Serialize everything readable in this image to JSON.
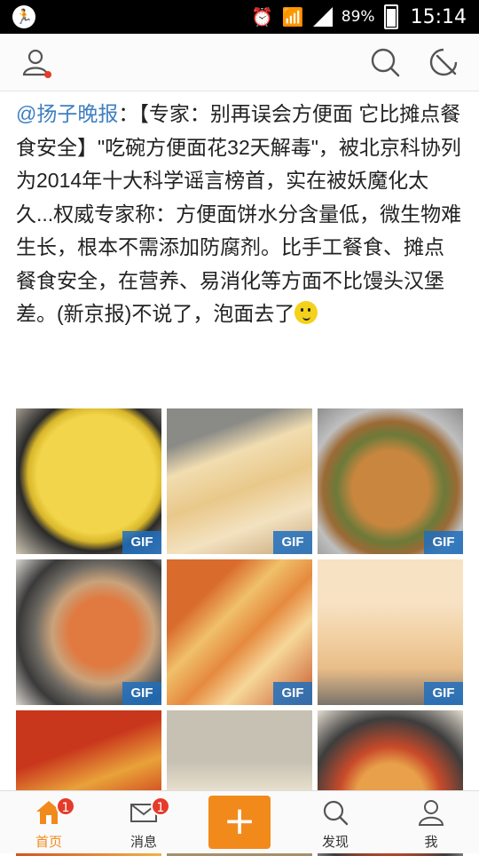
{
  "status_bar": {
    "battery": "89%",
    "time": "15:14"
  },
  "post": {
    "mention": "@扬子晚报",
    "text": "：【专家：别再误会方便面 它比摊点餐食安全】\"吃碗方便面花32天解毒\"，被北京科协列为2014年十大科学谣言榜首，实在被妖魔化太久...权威专家称：方便面饼水分含量低，微生物难生长，根本不需添加防腐剂。比手工餐食、摊点餐食安全，在营养、易消化等方面不比馒头汉堡差。(新京报)不说了，泡面去了",
    "images": [
      {
        "label": "GIF"
      },
      {
        "label": "GIF"
      },
      {
        "label": "GIF"
      },
      {
        "label": "GIF"
      },
      {
        "label": "GIF"
      },
      {
        "label": "GIF"
      },
      {
        "label": ""
      },
      {
        "label": ""
      },
      {
        "label": ""
      }
    ]
  },
  "tabs": {
    "home": "首页",
    "home_badge": "1",
    "messages": "消息",
    "messages_badge": "1",
    "compose": "+",
    "discover": "发现",
    "me": "我"
  },
  "icons": {
    "user": "user-icon",
    "search": "search-icon",
    "radar": "radar-icon"
  },
  "colors": {
    "accent": "#f28a1b",
    "link": "#3d7fc1",
    "badge": "#e53b2b",
    "gif_label": "#1e6ebe"
  }
}
